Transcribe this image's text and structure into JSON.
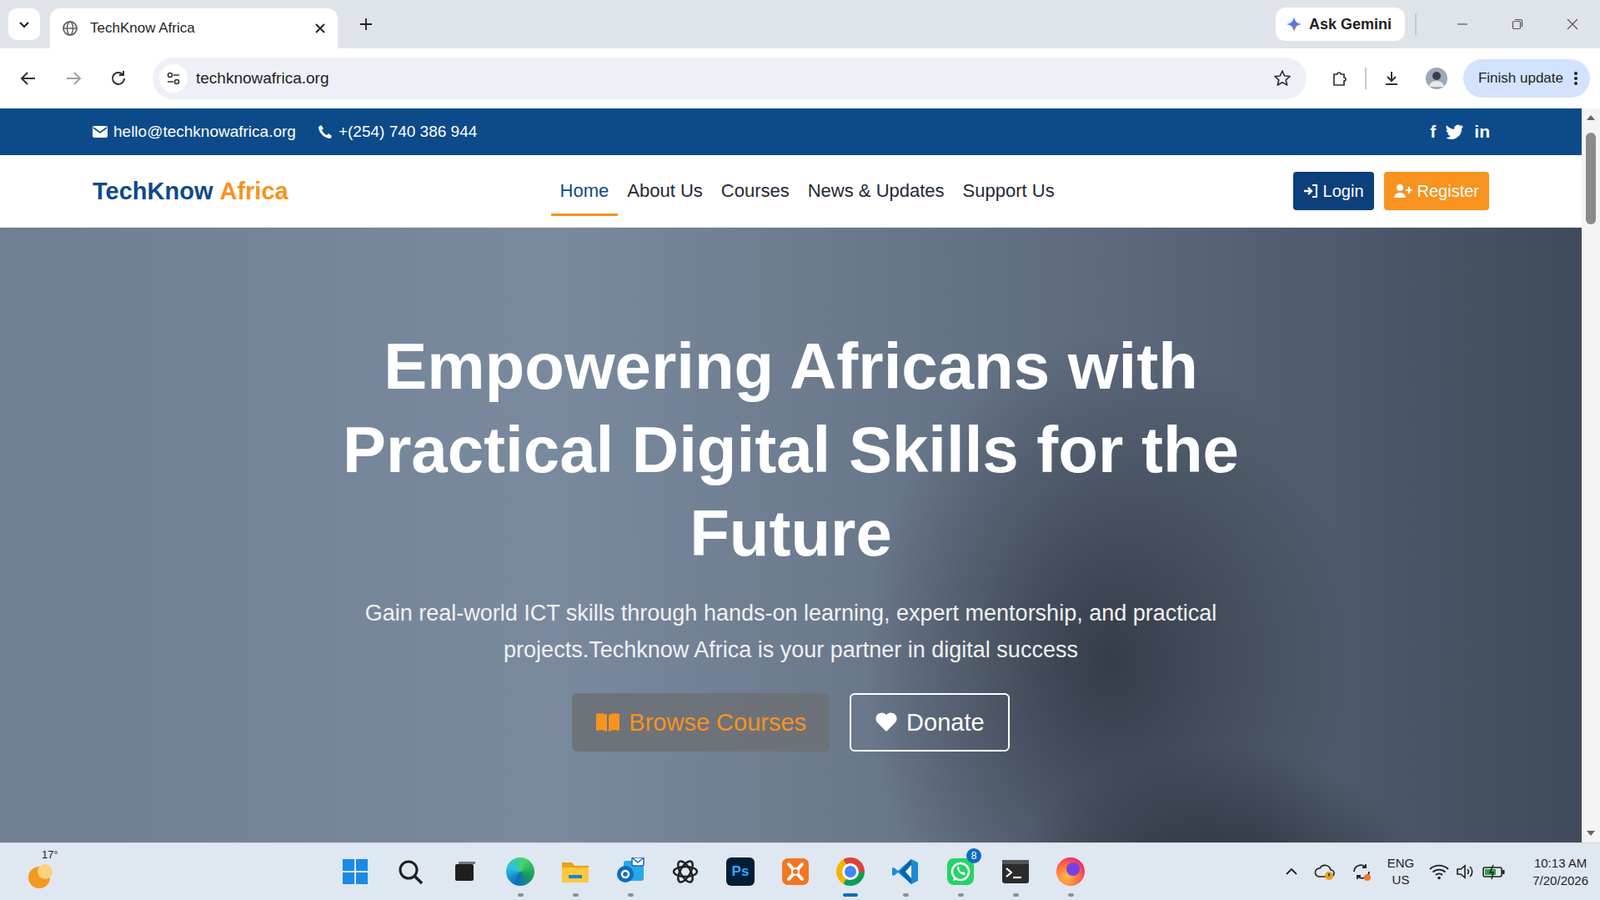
{
  "browser": {
    "tabs": [
      {
        "label": "TechKnow Africa",
        "selected": true
      }
    ],
    "gemini": "Ask Gemini",
    "address": "techknowafrica.org",
    "update": "Finish update",
    "scroll": {
      "level": 0.13
    }
  },
  "site": {
    "topbar": {
      "email": "hello@techknowafrica.org",
      "phone": "+(254) 740 386 944",
      "social": [
        {
          "kind": "text",
          "text": "f"
        },
        {
          "kind": "bird"
        },
        {
          "kind": "text",
          "text": "in"
        }
      ]
    },
    "logo": {
      "first": "TechKnow",
      "second": "Africa"
    },
    "nav": [
      {
        "label": "Home",
        "selected": true
      },
      {
        "label": "About Us",
        "selected": false
      },
      {
        "label": "Courses",
        "selected": false
      },
      {
        "label": "News & Updates",
        "selected": false
      },
      {
        "label": "Support Us",
        "selected": false
      }
    ],
    "login": "Login",
    "register": "Register",
    "hero": {
      "title": "Empowering Africans with Practical Digital Skills for the Future",
      "subtitle": "Gain real-world ICT skills through hands-on learning, expert mentorship, and practical projects.Techknow Africa is your partner in digital success",
      "primary": "Browse Courses",
      "secondary": "Donate"
    }
  },
  "taskbar": {
    "weather": "17°",
    "apps": [
      {
        "kind": "start",
        "running": false,
        "active": false
      },
      {
        "kind": "search",
        "running": false,
        "active": false
      },
      {
        "kind": "taskview",
        "running": false,
        "active": false
      },
      {
        "kind": "edge",
        "running": true,
        "active": false
      },
      {
        "kind": "explorer",
        "running": true,
        "active": false
      },
      {
        "kind": "outlook",
        "running": true,
        "active": false
      },
      {
        "kind": "chatgpt",
        "running": false,
        "active": false
      },
      {
        "kind": "photoshop",
        "label": "Ps",
        "running": false,
        "active": false
      },
      {
        "kind": "xampp",
        "running": false,
        "active": false
      },
      {
        "kind": "chrome",
        "running": true,
        "active": true
      },
      {
        "kind": "vscode",
        "running": true,
        "active": false
      },
      {
        "kind": "whatsapp",
        "badge": "8",
        "running": true,
        "active": false
      },
      {
        "kind": "terminal",
        "running": true,
        "active": false
      },
      {
        "kind": "firefox",
        "running": true,
        "active": false
      }
    ],
    "tray": {
      "lang": "ENG",
      "region": "US",
      "time": "10:13 AM",
      "date": "7/20/2026"
    }
  }
}
